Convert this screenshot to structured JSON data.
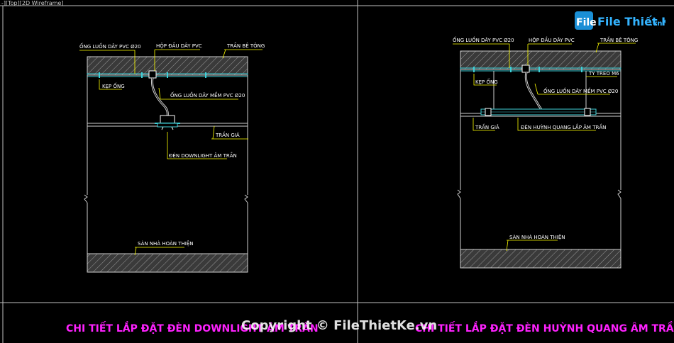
{
  "viewport": {
    "label": "-][Top][2D Wireframe]"
  },
  "logo": {
    "brand": "File Thiết Kế",
    "suffix": ".vn"
  },
  "watermark": {
    "text": "Copyright © FileThietKe.vn"
  },
  "colors": {
    "background": "#000000",
    "concrete_hatch": "#7a7a7a",
    "conduit": "#3fd0d8",
    "annotation_text": "#ffffff",
    "leader": "#ffff00",
    "title": "#ff22ff"
  },
  "left_detail": {
    "title": "CHI TIẾT LẮP ĐẶT ĐÈN DOWNLIGHT ÂM TRẦN",
    "labels": {
      "conduit_pvc": "ỐNG LUỒN DÂY PVC Ø20",
      "junction_box": "HỘP ĐẦU DÂY PVC",
      "concrete_ceiling": "TRẦN BÊ TÔNG",
      "pipe_clamp": "KẸP ỐNG",
      "flexible_conduit": "ỐNG LUỒN DÂY MỀM PVC Ø20",
      "false_ceiling": "TRẦN GIẢ",
      "downlight": "ĐÈN DOWNLIGHT ÂM TRẦN",
      "finished_floor": "SÀN NHÀ HOÀN THIỆN"
    }
  },
  "right_detail": {
    "title": "CHI TIẾT LẮP ĐẶT ĐÈN HUỲNH QUANG ÂM TRẦN",
    "labels": {
      "conduit_pvc": "ỐNG LUỒN DÂY PVC Ø20",
      "junction_box": "HỘP ĐẦU DÂY PVC",
      "concrete_ceiling": "TRẦN BÊ TÔNG",
      "threaded_rod": "TY TREO M6",
      "pipe_clamp": "KẸP ỐNG",
      "flexible_conduit": "ỐNG LUỒN DÂY MỀM PVC Ø20",
      "false_ceiling": "TRẦN GIẢ",
      "fluorescent": "ĐÈN HUỲNH QUANG LẮP ÂM TRẦN",
      "finished_floor": "SÀN NHÀ HOÀN THIỆN"
    }
  }
}
